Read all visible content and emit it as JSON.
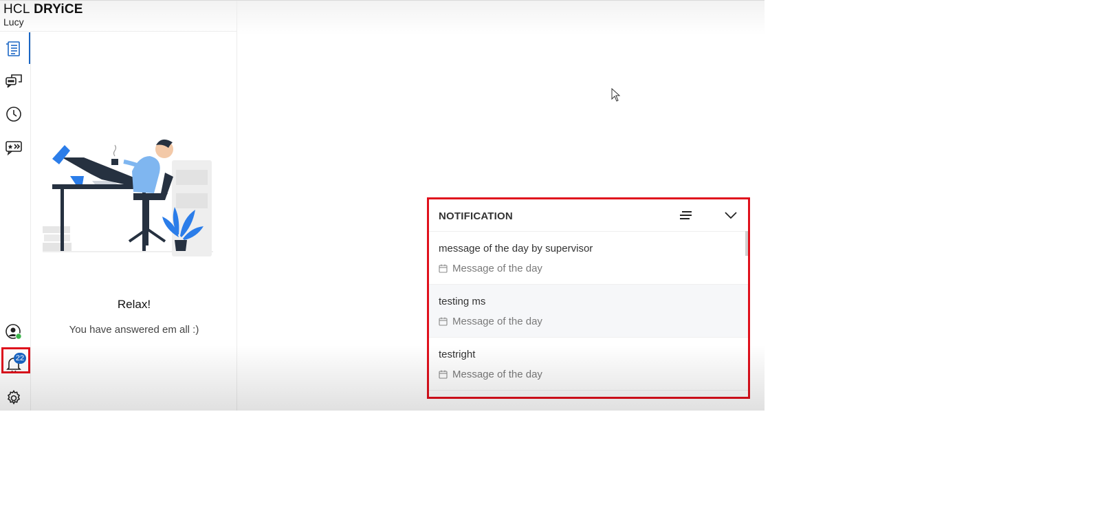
{
  "brand": {
    "logo_prefix": "HCL",
    "logo_name": "DRYiCE",
    "user": "Lucy"
  },
  "sidebar": {
    "items": [
      {
        "name": "tasks",
        "icon": "task-list-icon"
      },
      {
        "name": "chat",
        "icon": "chat-bubbles-icon"
      },
      {
        "name": "history",
        "icon": "clock-icon"
      },
      {
        "name": "ratings",
        "icon": "rating-bubble-icon"
      }
    ],
    "bottom": [
      {
        "name": "agent-status",
        "icon": "user-status-icon",
        "status_color": "#3bb54a"
      },
      {
        "name": "notifications",
        "icon": "bell-icon",
        "badge": "22"
      },
      {
        "name": "settings",
        "icon": "gear-icon"
      }
    ]
  },
  "empty_state": {
    "title": "Relax!",
    "subtitle": "You have answered em all :)"
  },
  "notification": {
    "title": "NOTIFICATION",
    "items": [
      {
        "title": "message of the day by supervisor",
        "category": "Message of the day"
      },
      {
        "title": "testing ms",
        "category": "Message of the day"
      },
      {
        "title": "testright",
        "category": "Message of the day"
      }
    ]
  },
  "colors": {
    "accent": "#1a66c4",
    "highlight": "#e0101c",
    "illustration_blue": "#2b7de9"
  }
}
